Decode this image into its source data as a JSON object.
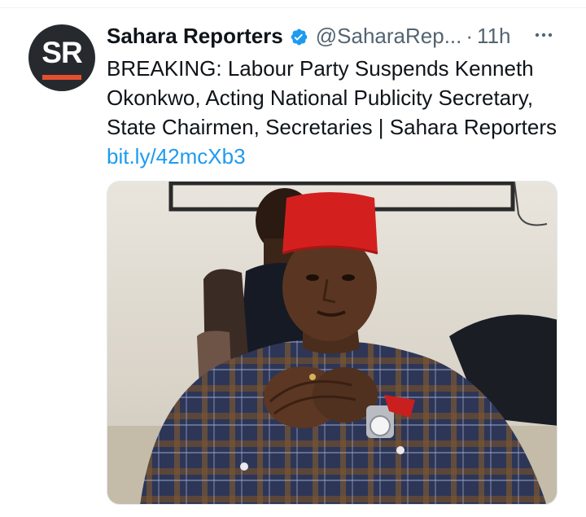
{
  "author": {
    "display_name": "Sahara Reporters",
    "avatar_text": "SR",
    "handle": "@SaharaRep...",
    "separator": "·",
    "time": "11h"
  },
  "tweet": {
    "text": "BREAKING: Labour Party Suspends Kenneth Okonkwo, Acting National Publicity Secretary, State Chairmen, Secretaries | Sahara Reporters ",
    "link": "bit.ly/42mcXb3"
  },
  "icons": {
    "verified": "verified-badge-icon",
    "more": "more-options-icon"
  },
  "colors": {
    "link": "#1d9bf0",
    "verified": "#1d9bf0",
    "secondary_text": "#536471",
    "avatar_bg": "#262a2e",
    "avatar_accent": "#e4502f"
  }
}
